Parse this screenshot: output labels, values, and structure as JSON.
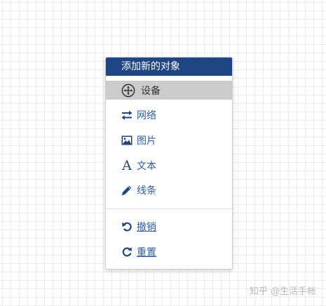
{
  "menu": {
    "title": "添加新的对象",
    "items": [
      {
        "label": "设备",
        "icon": "move-arrows-icon",
        "active": true
      },
      {
        "label": "网络",
        "icon": "exchange-arrows-icon"
      },
      {
        "label": "图片",
        "icon": "picture-icon"
      },
      {
        "label": "文本",
        "icon": "text-letter-icon",
        "glyph": "A"
      },
      {
        "label": "线条",
        "icon": "pencil-icon"
      },
      {
        "label": "撤销",
        "icon": "undo-icon"
      },
      {
        "label": "重置",
        "icon": "reset-icon"
      }
    ]
  },
  "colors": {
    "header_bg": "#1e4684",
    "item_text": "#2a5ea8",
    "active_bg": "#cccccc"
  },
  "watermark": "知乎 @生活手帐"
}
